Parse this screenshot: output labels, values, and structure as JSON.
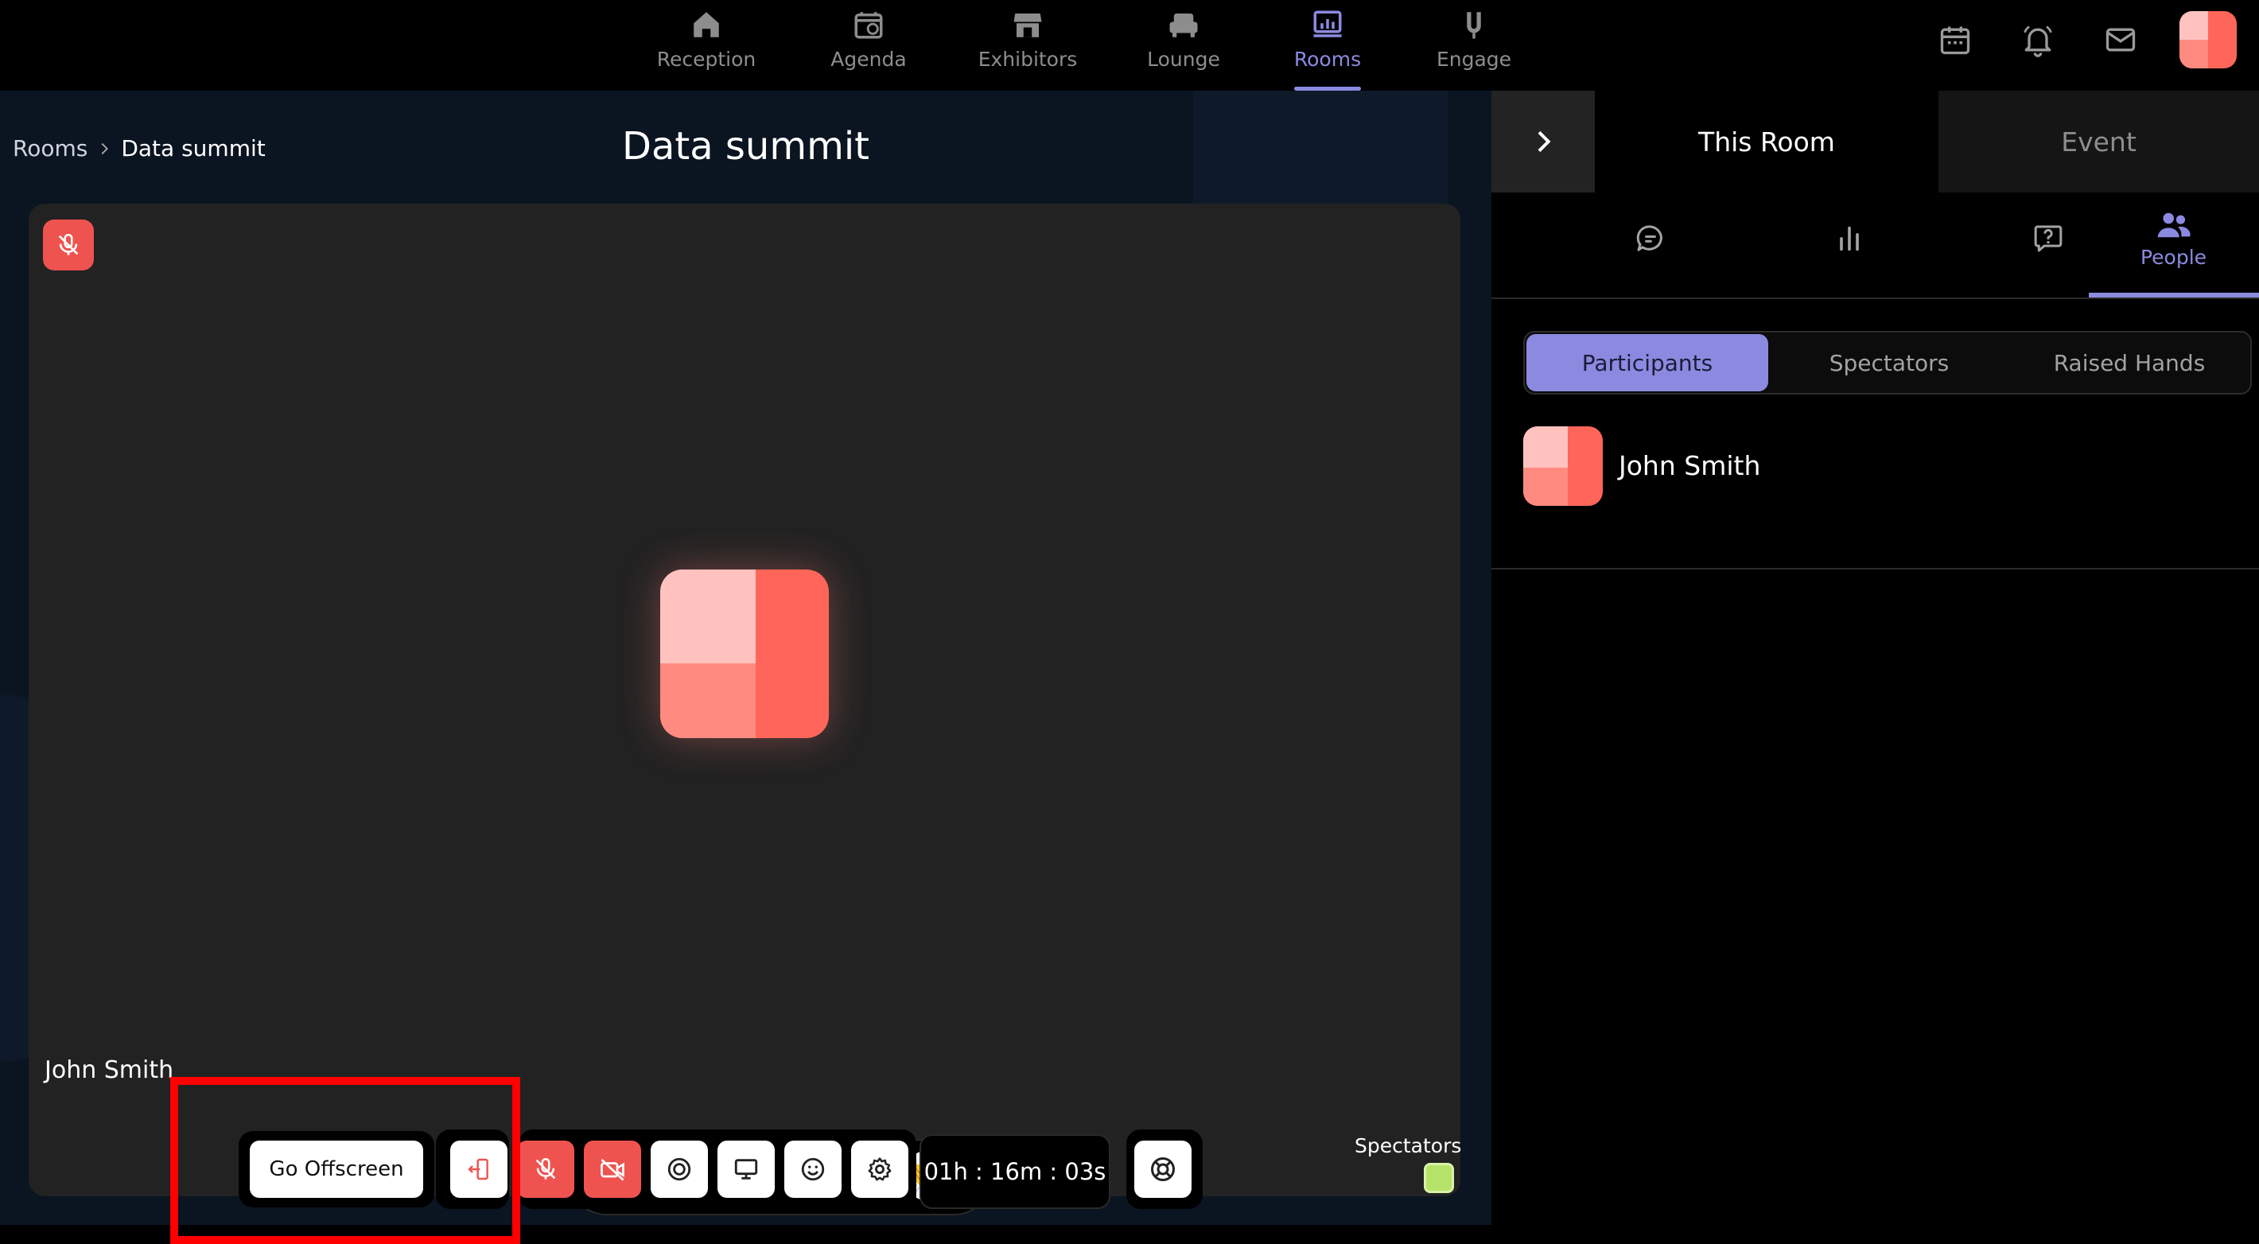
{
  "nav": {
    "items": [
      {
        "label": "Reception",
        "icon": "home-icon"
      },
      {
        "label": "Agenda",
        "icon": "calendar-clock-icon"
      },
      {
        "label": "Exhibitors",
        "icon": "store-icon"
      },
      {
        "label": "Lounge",
        "icon": "sofa-icon"
      },
      {
        "label": "Rooms",
        "icon": "presentation-icon",
        "active": true
      },
      {
        "label": "Engage",
        "icon": "magnet-icon"
      }
    ],
    "actions": [
      "calendar-icon",
      "bell-icon",
      "mail-icon"
    ]
  },
  "breadcrumb": {
    "root": "Rooms",
    "current": "Data summit"
  },
  "room_title": "Data summit",
  "tile": {
    "participant_name": "John Smith",
    "muted": true
  },
  "reactions": [
    "😍",
    "😂",
    "😯",
    "🎉",
    "💯",
    "👏"
  ],
  "controls": {
    "go_offscreen_label": "Go Offscreen",
    "timer": "01h : 16m : 03s",
    "spectators_label": "Spectators"
  },
  "panel": {
    "tabs": {
      "this_room": "This Room",
      "event": "Event"
    },
    "icon_tabs": {
      "people_label": "People"
    },
    "segments": [
      "Participants",
      "Spectators",
      "Raised Hands"
    ],
    "participants": [
      {
        "name": "John Smith"
      }
    ]
  },
  "colors": {
    "accent": "#8b8ae0",
    "danger": "#ef5350",
    "avatar_light": "#ffc2bf",
    "avatar_mid": "#ff8a80",
    "avatar_dark": "#ff6659"
  }
}
